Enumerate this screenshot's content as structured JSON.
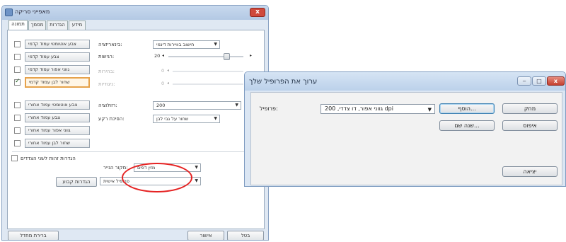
{
  "back_window": {
    "title": "מאפייני סריקה",
    "close_symbol": "x",
    "tabs": [
      "תמונה",
      "מסמך",
      "הגדרות",
      "מידע"
    ],
    "left_buttons": [
      {
        "label": "צבע אוטומטי עמוד קדמי",
        "checked": false
      },
      {
        "label": "צבע עמוד קדמי",
        "checked": false
      },
      {
        "label": "גווני אפור עמוד קדמי",
        "checked": false
      },
      {
        "label": "שחור לבן עמוד קדמי",
        "checked": true
      },
      {
        "label": "צבע אוטומטי עמוד אחורי",
        "checked": false
      },
      {
        "label": "צבע עמוד אחורי",
        "checked": false
      },
      {
        "label": "גווני אפור עמוד אחורי",
        "checked": false
      },
      {
        "label": "שחור לבן עמוד אחורי",
        "checked": false
      }
    ],
    "settings": {
      "binarization_label": "בינאריזציה:",
      "binarization_value": "חישוב בוויירות דינמי",
      "threshold_label": "רגישות:",
      "threshold_value": "20",
      "brightness_label": "בהירות:",
      "brightness_value": "0",
      "contrast_label": "ניגודיות:",
      "contrast_value": "0",
      "resolution_label": "רזולוציה:",
      "resolution_value": "200",
      "invert_label": "הפיכת רקע:",
      "invert_value": "שחור על גבי לבן"
    },
    "merge_label": "הגדרות זהות לשני הצדדים",
    "source_label": "מקור הנייר:",
    "source_value": "מזין דפים",
    "custom_button": "הגדרות קבוע",
    "profile_combo_value": "פרופיל אישית",
    "footer": {
      "defaults_button": "ברירת מחדל",
      "ok_button": "אישור",
      "cancel_button": "בטל"
    }
  },
  "dialog": {
    "title": "ערוך את הפרופיל שלך",
    "minimize_symbol": "‒",
    "maximize_symbol": "□",
    "close_symbol": "x",
    "profile_label": "פרופיל:",
    "profile_value": "גווני אפור, דו צדדי, 200 dpi",
    "add_button": "הוסף...",
    "rename_button": "שנה שם...",
    "delete_button": "מחק",
    "reset_button": "איפוס",
    "exit_button": "יציאה"
  }
}
